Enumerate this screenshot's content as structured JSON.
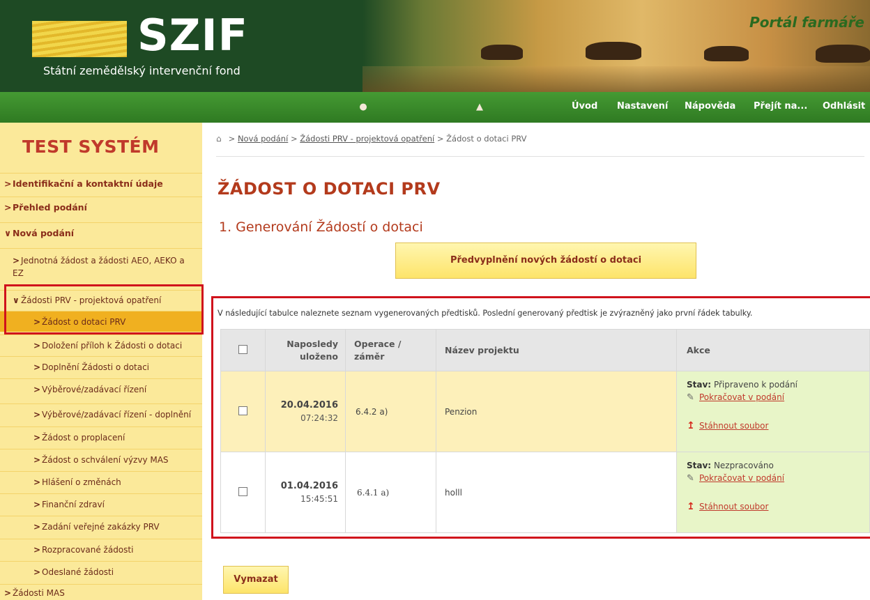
{
  "header": {
    "logo_text": "SZIF",
    "logo_subtitle": "Státní zemědělský intervenční fond",
    "portal_title": "Portál farmáře"
  },
  "topnav": {
    "links": [
      {
        "label": "Úvod"
      },
      {
        "label": "Nastavení"
      },
      {
        "label": "Nápověda"
      },
      {
        "label": "Přejít na..."
      },
      {
        "label": "Odhlásit"
      }
    ],
    "icons": [
      "user-icon",
      "user-settings-icon"
    ]
  },
  "sidebar": {
    "system_title": "TEST SYSTÉM",
    "items": [
      {
        "label": "Identifikační a kontaktní údaje",
        "level": 1
      },
      {
        "label": "Přehled podání",
        "level": 1
      },
      {
        "label": "Nová podání",
        "level": 1,
        "expanded": true
      },
      {
        "label": "Jednotná žádost a žádosti AEO, AEKO a EZ",
        "level": 2
      },
      {
        "label": "Žádosti PRV - projektová opatření",
        "level": 2,
        "expanded": true
      },
      {
        "label": "Žádost o dotaci PRV",
        "level": 3,
        "active": true
      },
      {
        "label": "Doložení příloh k Žádosti o dotaci",
        "level": 3
      },
      {
        "label": "Doplnění Žádosti o dotaci",
        "level": 3
      },
      {
        "label": "Výběrové/zadávací řízení",
        "level": 3
      },
      {
        "label": "Výběrové/zadávací řízení - doplnění",
        "level": 3
      },
      {
        "label": "Žádost o proplacení",
        "level": 3
      },
      {
        "label": "Žádost o schválení výzvy MAS",
        "level": 3
      },
      {
        "label": "Hlášení o změnách",
        "level": 3
      },
      {
        "label": "Finanční zdraví",
        "level": 3
      },
      {
        "label": "Zadání veřejné zakázky PRV",
        "level": 3
      },
      {
        "label": "Rozpracované žádosti",
        "level": 3
      },
      {
        "label": "Odeslané žádosti",
        "level": 3
      },
      {
        "label": "Žádosti MAS",
        "level": 2
      }
    ]
  },
  "breadcrumb": {
    "items": [
      "Nová podání",
      "Žádosti PRV - projektová opatření"
    ],
    "current": "Žádost o dotaci PRV",
    "sep": ">"
  },
  "main": {
    "title": "ŽÁDOST O DOTACI PRV",
    "section_title": "1. Generování Žádostí o dotaci",
    "prefill_button": "Předvyplnění nových žádostí o dotaci",
    "info_text": "V následující tabulce naleznete seznam vygenerovaných předtisků. Poslední generovaný předtisk je zvýrazněný jako první řádek tabulky.",
    "delete_button": "Vymazat"
  },
  "table": {
    "headers": {
      "saved": "Naposledy uloženo",
      "operation": "Operace / záměr",
      "project": "Název projektu",
      "actions": "Akce"
    },
    "rows": [
      {
        "date": "20.04.2016",
        "time": "07:24:32",
        "operation": "6.4.2 a)",
        "project": "Penzion",
        "status_label": "Stav:",
        "status": "Připraveno k podání",
        "continue_link": "Pokračovat v podání",
        "download_link": "Stáhnout soubor"
      },
      {
        "date": "01.04.2016",
        "time": "15:45:51",
        "operation": "6.4.1 a)",
        "project": "holll",
        "status_label": "Stav:",
        "status": "Nezpracováno",
        "continue_link": "Pokračovat v podání",
        "download_link": "Stáhnout soubor"
      }
    ]
  },
  "colors": {
    "header_green": "#1e4a24",
    "nav_green": "#3e8c2e",
    "sidebar_yellow": "#fbe99a",
    "active_orange": "#f0b020",
    "title_red": "#b33a1c",
    "highlight_red": "#d0121c"
  }
}
